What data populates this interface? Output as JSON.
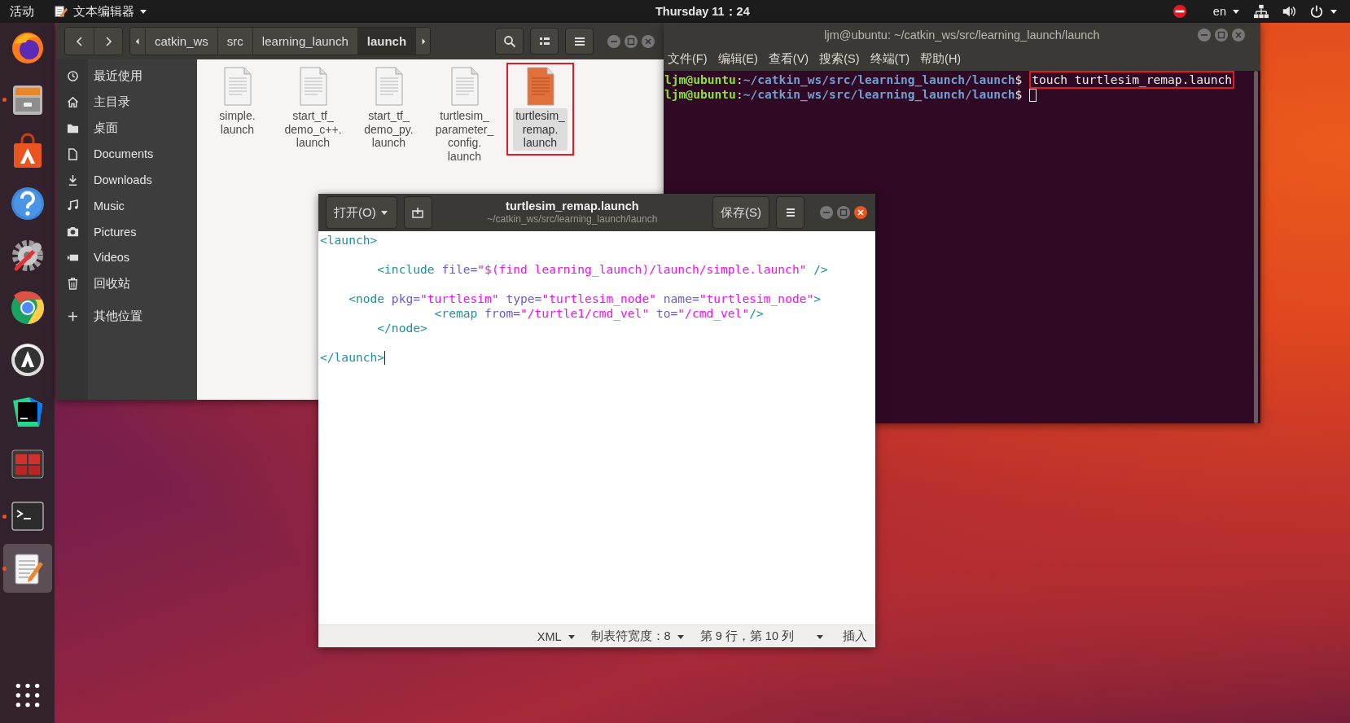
{
  "top_bar": {
    "activities": "活动",
    "app_menu": "文本编辑器",
    "clock": "Thursday 11：24",
    "language": "en"
  },
  "dock": {
    "items": [
      {
        "kind": "firefox",
        "running": false,
        "selected": false
      },
      {
        "kind": "files",
        "running": true,
        "selected": false
      },
      {
        "kind": "software",
        "running": false,
        "selected": false
      },
      {
        "kind": "help",
        "running": false,
        "selected": false
      },
      {
        "kind": "settings",
        "running": false,
        "selected": false
      },
      {
        "kind": "chrome",
        "running": false,
        "selected": false
      },
      {
        "kind": "updater",
        "running": false,
        "selected": false
      },
      {
        "kind": "ide",
        "running": false,
        "selected": false
      },
      {
        "kind": "grid_app",
        "running": false,
        "selected": false
      },
      {
        "kind": "terminal",
        "running": true,
        "selected": false
      },
      {
        "kind": "editor",
        "running": true,
        "selected": true
      }
    ]
  },
  "file_manager": {
    "path": [
      {
        "label": "catkin_ws",
        "selected": false
      },
      {
        "label": "src",
        "selected": false
      },
      {
        "label": "learning_launch",
        "selected": false
      },
      {
        "label": "launch",
        "selected": true
      }
    ],
    "sidebar": [
      {
        "kind": "recent",
        "label": "最近使用"
      },
      {
        "kind": "home",
        "label": "主目录"
      },
      {
        "kind": "desktop",
        "label": "桌面"
      },
      {
        "kind": "documents",
        "label": "Documents"
      },
      {
        "kind": "downloads",
        "label": "Downloads"
      },
      {
        "kind": "music",
        "label": "Music"
      },
      {
        "kind": "pictures",
        "label": "Pictures"
      },
      {
        "kind": "videos",
        "label": "Videos"
      },
      {
        "kind": "trash",
        "label": "回收站"
      },
      {
        "kind": "other",
        "label": "其他位置"
      }
    ],
    "files": [
      {
        "name_lines": [
          "simple.",
          "launch"
        ],
        "selected": false,
        "highlighted": false
      },
      {
        "name_lines": [
          "start_tf_",
          "demo_c++.",
          "launch"
        ],
        "selected": false,
        "highlighted": false
      },
      {
        "name_lines": [
          "start_tf_",
          "demo_py.",
          "launch"
        ],
        "selected": false,
        "highlighted": false
      },
      {
        "name_lines": [
          "turtlesim_",
          "parameter_",
          "config.",
          "launch"
        ],
        "selected": false,
        "highlighted": false
      },
      {
        "name_lines": [
          "turtlesim_",
          "remap.",
          "launch"
        ],
        "selected": true,
        "highlighted": true
      }
    ]
  },
  "terminal": {
    "title": "ljm@ubuntu: ~/catkin_ws/src/learning_launch/launch",
    "menu": [
      "文件(F)",
      "编辑(E)",
      "查看(V)",
      "搜索(S)",
      "终端(T)",
      "帮助(H)"
    ],
    "lines": [
      {
        "user": "ljm@ubuntu",
        "separator": ":",
        "path": "~/catkin_ws/src/learning_launch/launch",
        "prompt": "$ ",
        "command": "touch turtlesim_remap.launch",
        "highlighted": true,
        "cursor": false
      },
      {
        "user": "ljm@ubuntu",
        "separator": ":",
        "path": "~/catkin_ws/src/learning_launch/launch",
        "prompt": "$ ",
        "cursor": true
      }
    ]
  },
  "editor": {
    "open_button": "打开(O)",
    "title": "turtlesim_remap.launch",
    "subtitle": "~/catkin_ws/src/learning_launch/launch",
    "save_button": "保存(S)",
    "lines": [
      {
        "kind": "code",
        "cursor": false,
        "tokens": [
          {
            "kind": "tag",
            "text": "<launch>"
          }
        ]
      },
      {
        "kind": "blank"
      },
      {
        "kind": "code",
        "cursor": false,
        "tokens": [
          {
            "kind": "tag",
            "text": "        <include"
          },
          {
            "kind": "attr",
            "text": " file="
          },
          {
            "kind": "string",
            "text": "\"$(find learning_launch)/launch/simple.launch\""
          },
          {
            "kind": "tag",
            "text": " />"
          }
        ]
      },
      {
        "kind": "blank"
      },
      {
        "kind": "code",
        "cursor": false,
        "tokens": [
          {
            "kind": "tag",
            "text": "    <node"
          },
          {
            "kind": "attr",
            "text": " pkg="
          },
          {
            "kind": "string",
            "text": "\"turtlesim\""
          },
          {
            "kind": "attr",
            "text": " type="
          },
          {
            "kind": "string",
            "text": "\"turtlesim_node\""
          },
          {
            "kind": "attr",
            "text": " name="
          },
          {
            "kind": "string",
            "text": "\"turtlesim_node\""
          },
          {
            "kind": "tag",
            "text": ">"
          }
        ]
      },
      {
        "kind": "code",
        "cursor": false,
        "tokens": [
          {
            "kind": "tag",
            "text": "                <remap"
          },
          {
            "kind": "attr",
            "text": " from="
          },
          {
            "kind": "string",
            "text": "\"/turtle1/cmd_vel\""
          },
          {
            "kind": "attr",
            "text": " to="
          },
          {
            "kind": "string",
            "text": "\"/cmd_vel\""
          },
          {
            "kind": "tag",
            "text": "/>"
          }
        ]
      },
      {
        "kind": "code",
        "cursor": false,
        "tokens": [
          {
            "kind": "tag",
            "text": "        </node>"
          }
        ]
      },
      {
        "kind": "blank"
      },
      {
        "kind": "code",
        "cursor": true,
        "tokens": [
          {
            "kind": "tag",
            "text": "</launch>"
          }
        ]
      }
    ],
    "status": {
      "language": "XML",
      "tab_width": "制表符宽度：8",
      "position": "第 9 行，第 10 列",
      "mode": "插入"
    }
  }
}
